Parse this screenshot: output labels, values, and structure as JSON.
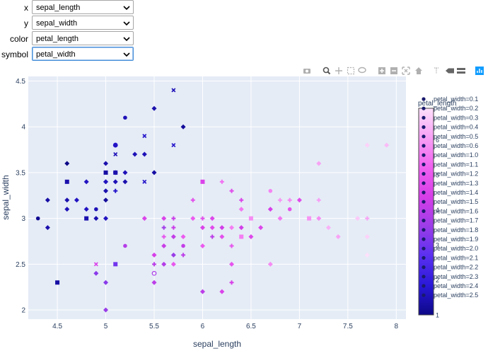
{
  "controls": [
    {
      "label": "x",
      "value": "sepal_length"
    },
    {
      "label": "y",
      "value": "sepal_width"
    },
    {
      "label": "color",
      "value": "petal_length"
    },
    {
      "label": "symbol",
      "value": "petal_width"
    }
  ],
  "modebar": {
    "icons": [
      "camera-icon",
      "zoom-icon",
      "pan-icon",
      "box-select-icon",
      "lasso-icon",
      "zoom-in-icon",
      "zoom-out-icon",
      "autoscale-icon",
      "reset-axes-icon",
      "spike-lines-icon",
      "hover-closest-icon",
      "hover-compare-icon",
      "plotly-logo-icon"
    ]
  },
  "chart_data": {
    "type": "scatter",
    "xlabel": "sepal_length",
    "ylabel": "sepal_width",
    "xlim": [
      4.2,
      8.1
    ],
    "ylim": [
      1.9,
      4.55
    ],
    "x_ticks": [
      "4.5",
      "5",
      "5.5",
      "6",
      "6.5",
      "7",
      "7.5",
      "8"
    ],
    "x_tick_values": [
      4.5,
      5,
      5.5,
      6,
      6.5,
      7,
      7.5,
      8
    ],
    "y_ticks": [
      "2",
      "2.5",
      "3",
      "3.5",
      "4",
      "4.5"
    ],
    "y_tick_values": [
      2,
      2.5,
      3,
      3.5,
      4,
      4.5
    ],
    "grid": true,
    "colorbar": {
      "title": "petal_length",
      "min": 1,
      "max": 6.9,
      "ticks": [
        "1",
        "2",
        "3",
        "4",
        "5",
        "6"
      ],
      "tick_values": [
        1,
        2,
        3,
        4,
        5,
        6
      ],
      "colors": [
        "#0d0887",
        "#2a18d8",
        "#5a30f0",
        "#9b3de8",
        "#d63ee8",
        "#f060f0",
        "#f8a0f5",
        "#fde0fb"
      ]
    },
    "legend": {
      "position": "right",
      "entries": [
        "petal_width=0.1",
        "petal_width=0.2",
        "petal_width=0.3",
        "petal_width=0.4",
        "petal_width=0.5",
        "petal_width=0.6",
        "petal_width=1.0",
        "petal_width=1.1",
        "petal_width=1.2",
        "petal_width=1.3",
        "petal_width=1.4",
        "petal_width=1.5",
        "petal_width=1.6",
        "petal_width=1.7",
        "petal_width=1.8",
        "petal_width=1.9",
        "petal_width=2.0",
        "petal_width=2.1",
        "petal_width=2.2",
        "petal_width=2.3",
        "petal_width=2.4",
        "petal_width=2.5"
      ]
    },
    "points": [
      {
        "x": 4.3,
        "y": 3.0,
        "c": 1.1,
        "s": 0
      },
      {
        "x": 4.4,
        "y": 2.9,
        "c": 1.4,
        "s": 1
      },
      {
        "x": 4.4,
        "y": 3.2,
        "c": 1.3,
        "s": 1
      },
      {
        "x": 4.5,
        "y": 2.3,
        "c": 1.3,
        "s": 2
      },
      {
        "x": 4.6,
        "y": 3.6,
        "c": 1.0,
        "s": 1
      },
      {
        "x": 4.6,
        "y": 3.4,
        "c": 1.4,
        "s": 2
      },
      {
        "x": 4.6,
        "y": 3.1,
        "c": 1.5,
        "s": 1
      },
      {
        "x": 4.6,
        "y": 3.2,
        "c": 1.4,
        "s": 1
      },
      {
        "x": 4.7,
        "y": 3.2,
        "c": 1.6,
        "s": 1
      },
      {
        "x": 4.8,
        "y": 3.4,
        "c": 1.6,
        "s": 1
      },
      {
        "x": 4.8,
        "y": 3.0,
        "c": 1.4,
        "s": 2
      },
      {
        "x": 4.8,
        "y": 3.1,
        "c": 1.6,
        "s": 1
      },
      {
        "x": 4.9,
        "y": 3.0,
        "c": 1.4,
        "s": 1
      },
      {
        "x": 4.9,
        "y": 3.1,
        "c": 1.5,
        "s": 0
      },
      {
        "x": 4.9,
        "y": 2.5,
        "c": 4.5,
        "s": 4
      },
      {
        "x": 4.9,
        "y": 2.4,
        "c": 3.3,
        "s": 1
      },
      {
        "x": 5.0,
        "y": 3.6,
        "c": 1.4,
        "s": 1
      },
      {
        "x": 5.0,
        "y": 3.4,
        "c": 1.5,
        "s": 1
      },
      {
        "x": 5.0,
        "y": 3.0,
        "c": 1.6,
        "s": 1
      },
      {
        "x": 5.0,
        "y": 3.5,
        "c": 1.3,
        "s": 2
      },
      {
        "x": 5.0,
        "y": 3.3,
        "c": 1.4,
        "s": 1
      },
      {
        "x": 5.0,
        "y": 3.2,
        "c": 1.2,
        "s": 1
      },
      {
        "x": 5.0,
        "y": 2.3,
        "c": 3.3,
        "s": 1
      },
      {
        "x": 5.0,
        "y": 2.0,
        "c": 3.5,
        "s": 1
      },
      {
        "x": 5.0,
        "y": 3.4,
        "c": 1.6,
        "s": 3
      },
      {
        "x": 5.1,
        "y": 3.5,
        "c": 1.4,
        "s": 1
      },
      {
        "x": 5.1,
        "y": 3.8,
        "c": 1.9,
        "s": 5
      },
      {
        "x": 5.1,
        "y": 3.7,
        "c": 1.5,
        "s": 4
      },
      {
        "x": 5.1,
        "y": 3.3,
        "c": 1.7,
        "s": 6
      },
      {
        "x": 5.1,
        "y": 3.4,
        "c": 1.5,
        "s": 1
      },
      {
        "x": 5.1,
        "y": 3.5,
        "c": 1.4,
        "s": 2
      },
      {
        "x": 5.1,
        "y": 2.5,
        "c": 3.0,
        "s": 2
      },
      {
        "x": 5.1,
        "y": 3.8,
        "c": 1.6,
        "s": 1
      },
      {
        "x": 5.2,
        "y": 4.1,
        "c": 1.5,
        "s": 0
      },
      {
        "x": 5.2,
        "y": 3.5,
        "c": 1.5,
        "s": 1
      },
      {
        "x": 5.2,
        "y": 3.4,
        "c": 1.4,
        "s": 1
      },
      {
        "x": 5.2,
        "y": 2.7,
        "c": 3.9,
        "s": 0
      },
      {
        "x": 5.3,
        "y": 3.7,
        "c": 1.5,
        "s": 1
      },
      {
        "x": 5.4,
        "y": 3.9,
        "c": 1.7,
        "s": 4
      },
      {
        "x": 5.4,
        "y": 3.7,
        "c": 1.5,
        "s": 1
      },
      {
        "x": 5.4,
        "y": 3.4,
        "c": 1.7,
        "s": 4
      },
      {
        "x": 5.4,
        "y": 3.0,
        "c": 4.5,
        "s": 1
      },
      {
        "x": 5.5,
        "y": 4.2,
        "c": 1.4,
        "s": 1
      },
      {
        "x": 5.5,
        "y": 3.5,
        "c": 1.3,
        "s": 1
      },
      {
        "x": 5.5,
        "y": 2.3,
        "c": 4.0,
        "s": 1
      },
      {
        "x": 5.5,
        "y": 2.4,
        "c": 3.8,
        "s": 5
      },
      {
        "x": 5.5,
        "y": 2.5,
        "c": 4.0,
        "s": 6
      },
      {
        "x": 5.5,
        "y": 2.6,
        "c": 4.4,
        "s": 1
      },
      {
        "x": 5.6,
        "y": 2.9,
        "c": 3.6,
        "s": 6
      },
      {
        "x": 5.6,
        "y": 3.0,
        "c": 4.5,
        "s": 1
      },
      {
        "x": 5.6,
        "y": 2.5,
        "c": 3.9,
        "s": 1
      },
      {
        "x": 5.6,
        "y": 2.8,
        "c": 4.9,
        "s": 6
      },
      {
        "x": 5.6,
        "y": 2.7,
        "c": 4.2,
        "s": 1
      },
      {
        "x": 5.7,
        "y": 4.4,
        "c": 1.5,
        "s": 4
      },
      {
        "x": 5.7,
        "y": 3.8,
        "c": 1.7,
        "s": 4
      },
      {
        "x": 5.7,
        "y": 2.6,
        "c": 3.5,
        "s": 1
      },
      {
        "x": 5.7,
        "y": 2.9,
        "c": 4.2,
        "s": 6
      },
      {
        "x": 5.7,
        "y": 2.8,
        "c": 4.1,
        "s": 1
      },
      {
        "x": 5.7,
        "y": 2.5,
        "c": 5.0,
        "s": 1
      },
      {
        "x": 5.7,
        "y": 3.0,
        "c": 4.2,
        "s": 6
      },
      {
        "x": 5.8,
        "y": 4.0,
        "c": 1.2,
        "s": 1
      },
      {
        "x": 5.8,
        "y": 2.7,
        "c": 4.1,
        "s": 0
      },
      {
        "x": 5.8,
        "y": 2.6,
        "c": 4.0,
        "s": 6
      },
      {
        "x": 5.8,
        "y": 2.8,
        "c": 5.1,
        "s": 1
      },
      {
        "x": 5.9,
        "y": 3.2,
        "c": 4.8,
        "s": 6
      },
      {
        "x": 5.9,
        "y": 3.0,
        "c": 5.1,
        "s": 1
      },
      {
        "x": 6.0,
        "y": 2.2,
        "c": 4.0,
        "s": 1
      },
      {
        "x": 6.0,
        "y": 2.9,
        "c": 4.5,
        "s": 1
      },
      {
        "x": 6.0,
        "y": 3.4,
        "c": 4.5,
        "s": 2
      },
      {
        "x": 6.0,
        "y": 2.7,
        "c": 5.1,
        "s": 1
      },
      {
        "x": 6.0,
        "y": 3.0,
        "c": 4.8,
        "s": 6
      },
      {
        "x": 6.1,
        "y": 2.9,
        "c": 4.7,
        "s": 1
      },
      {
        "x": 6.1,
        "y": 2.8,
        "c": 4.0,
        "s": 6
      },
      {
        "x": 6.1,
        "y": 3.0,
        "c": 4.6,
        "s": 1
      },
      {
        "x": 6.2,
        "y": 2.2,
        "c": 4.5,
        "s": 1
      },
      {
        "x": 6.2,
        "y": 2.9,
        "c": 4.3,
        "s": 1
      },
      {
        "x": 6.2,
        "y": 3.4,
        "c": 5.4,
        "s": 6
      },
      {
        "x": 6.2,
        "y": 2.8,
        "c": 4.8,
        "s": 1
      },
      {
        "x": 6.3,
        "y": 3.3,
        "c": 4.7,
        "s": 3
      },
      {
        "x": 6.3,
        "y": 2.5,
        "c": 4.9,
        "s": 1
      },
      {
        "x": 6.3,
        "y": 2.3,
        "c": 4.4,
        "s": 6
      },
      {
        "x": 6.3,
        "y": 2.9,
        "c": 5.6,
        "s": 1
      },
      {
        "x": 6.3,
        "y": 2.7,
        "c": 4.9,
        "s": 6
      },
      {
        "x": 6.4,
        "y": 3.2,
        "c": 4.5,
        "s": 6
      },
      {
        "x": 6.4,
        "y": 2.9,
        "c": 4.3,
        "s": 1
      },
      {
        "x": 6.4,
        "y": 2.8,
        "c": 5.6,
        "s": 2
      },
      {
        "x": 6.4,
        "y": 3.1,
        "c": 5.5,
        "s": 1
      },
      {
        "x": 6.5,
        "y": 2.8,
        "c": 4.6,
        "s": 1
      },
      {
        "x": 6.5,
        "y": 3.0,
        "c": 5.8,
        "s": 2
      },
      {
        "x": 6.6,
        "y": 2.9,
        "c": 4.6,
        "s": 1
      },
      {
        "x": 6.7,
        "y": 3.1,
        "c": 4.4,
        "s": 1
      },
      {
        "x": 6.7,
        "y": 3.3,
        "c": 5.7,
        "s": 0
      },
      {
        "x": 6.7,
        "y": 2.5,
        "c": 5.8,
        "s": 1
      },
      {
        "x": 6.8,
        "y": 3.0,
        "c": 5.5,
        "s": 1
      },
      {
        "x": 6.8,
        "y": 3.2,
        "c": 5.9,
        "s": 6
      },
      {
        "x": 6.9,
        "y": 3.1,
        "c": 4.9,
        "s": 0
      },
      {
        "x": 6.9,
        "y": 3.2,
        "c": 5.7,
        "s": 6
      },
      {
        "x": 7.0,
        "y": 3.2,
        "c": 4.7,
        "s": 1
      },
      {
        "x": 7.1,
        "y": 3.0,
        "c": 5.9,
        "s": 2
      },
      {
        "x": 7.2,
        "y": 3.6,
        "c": 6.1,
        "s": 1
      },
      {
        "x": 7.2,
        "y": 3.2,
        "c": 6.0,
        "s": 6
      },
      {
        "x": 7.2,
        "y": 3.0,
        "c": 5.8,
        "s": 1
      },
      {
        "x": 7.3,
        "y": 2.9,
        "c": 6.3,
        "s": 1
      },
      {
        "x": 7.4,
        "y": 2.8,
        "c": 6.1,
        "s": 1
      },
      {
        "x": 7.6,
        "y": 3.0,
        "c": 6.6,
        "s": 1
      },
      {
        "x": 7.7,
        "y": 3.8,
        "c": 6.7,
        "s": 1
      },
      {
        "x": 7.7,
        "y": 2.6,
        "c": 6.9,
        "s": 1
      },
      {
        "x": 7.7,
        "y": 2.8,
        "c": 6.7,
        "s": 1
      },
      {
        "x": 7.7,
        "y": 3.0,
        "c": 6.1,
        "s": 6
      },
      {
        "x": 7.9,
        "y": 3.8,
        "c": 6.4,
        "s": 1
      }
    ]
  }
}
